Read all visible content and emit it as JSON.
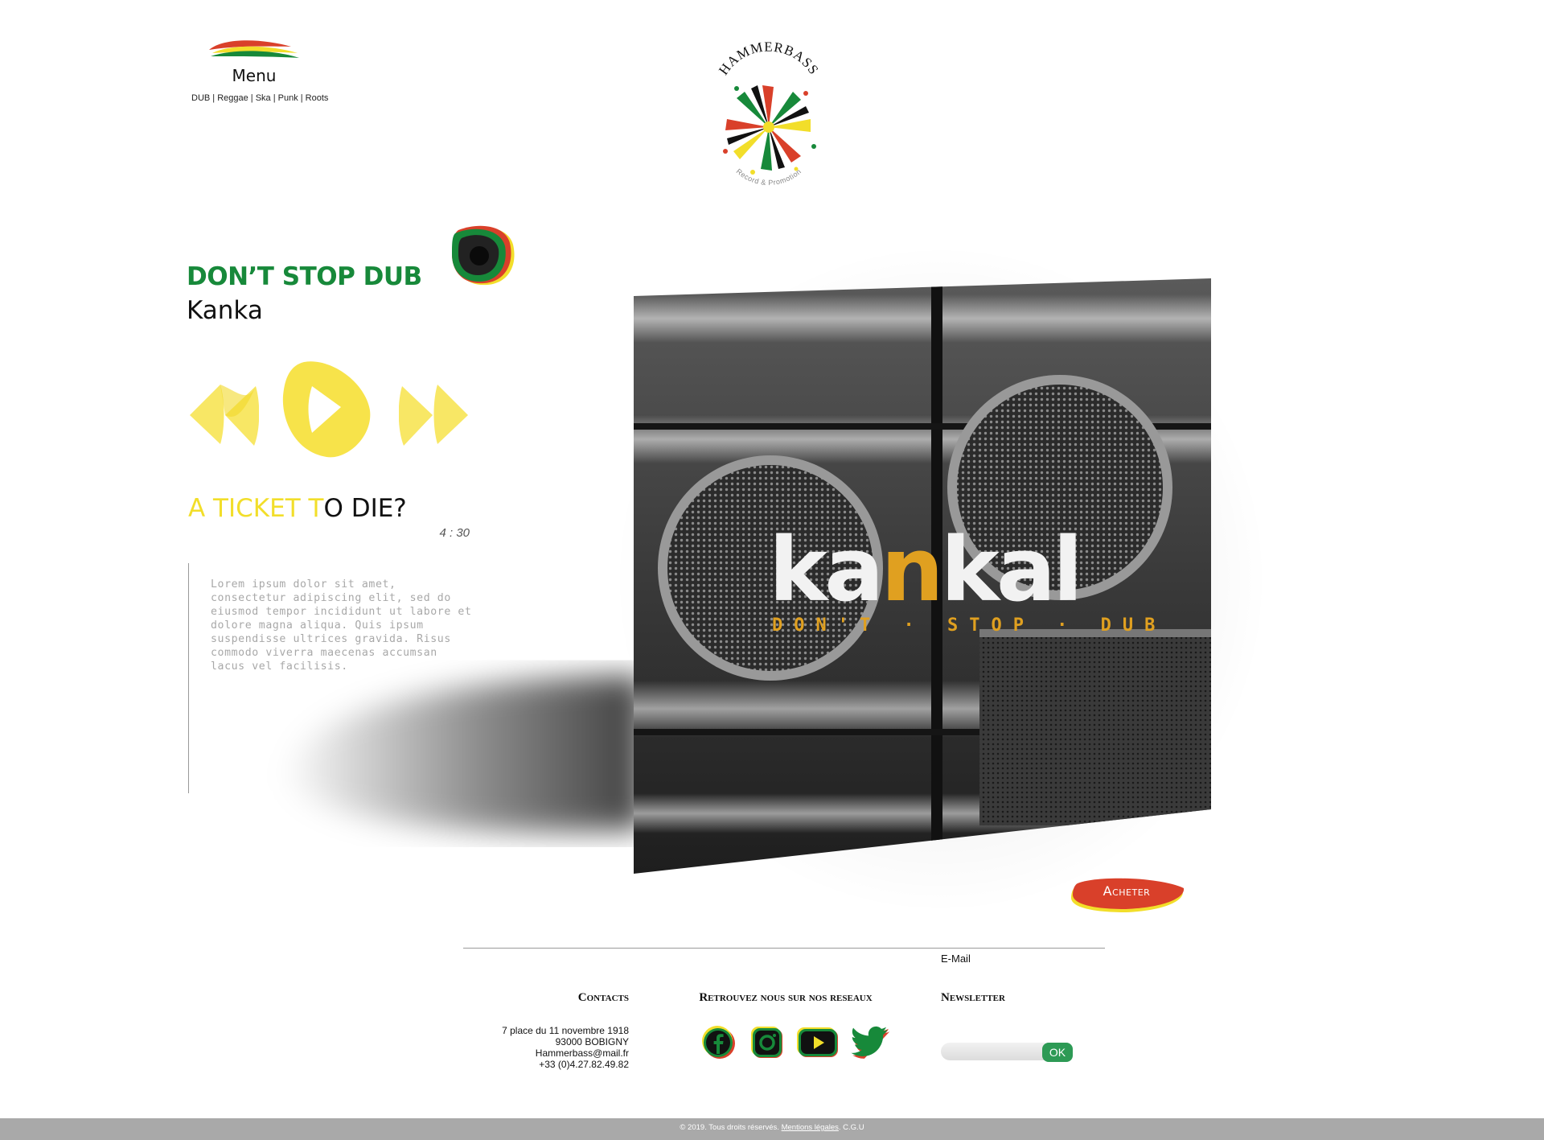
{
  "header": {
    "menu_label": "Menu",
    "genres": "DUB | Reggae | Ska | Punk | Roots",
    "logo": {
      "name": "HAMMERBASS",
      "tagline": "Record & Promotion"
    }
  },
  "player": {
    "album_title": "DON’T STOP DUB",
    "artist": "Kanka",
    "track": {
      "title_highlight": "A TICKET T",
      "title_rest": "O DIE?",
      "duration": "4 : 30"
    },
    "description": "Lorem ipsum dolor sit amet, consectetur adipiscing elit, sed do eiusmod tempor incididunt ut labore et dolore magna aliqua. Quis ipsum suspendisse ultrices gravida. Risus commodo viverra maecenas accumsan lacus vel facilisis.",
    "controls": {
      "prev_icon": "rewind-icon",
      "play_icon": "play-icon",
      "next_icon": "fast-forward-icon"
    }
  },
  "cover": {
    "artist_text": "kankal",
    "subtitle_text": "DON'T · STOP · DUB"
  },
  "buy_button": "Acheter",
  "footer": {
    "email_label": "E-Mail",
    "contacts": {
      "heading": "Contacts",
      "lines": [
        "7 place du 11 novembre 1918",
        "93000 BOBIGNY",
        "Hammerbass@mail.fr",
        "+33 (0)4.27.82.49.82"
      ]
    },
    "social": {
      "heading": "Retrouvez nous sur nos reseaux",
      "icons": [
        "facebook-icon",
        "instagram-icon",
        "youtube-icon",
        "twitter-icon"
      ]
    },
    "newsletter": {
      "heading": "Newsletter",
      "placeholder": "",
      "button": "OK"
    },
    "copyright": {
      "prefix": "© 2019. Tous droits réservés. ",
      "legal": "Mentions légales",
      "suffix": ". C.G.U"
    }
  },
  "colors": {
    "green": "#17893a",
    "yellow": "#f2de2a",
    "red": "#d9402a",
    "footer_bar": "#a9a9a9"
  }
}
